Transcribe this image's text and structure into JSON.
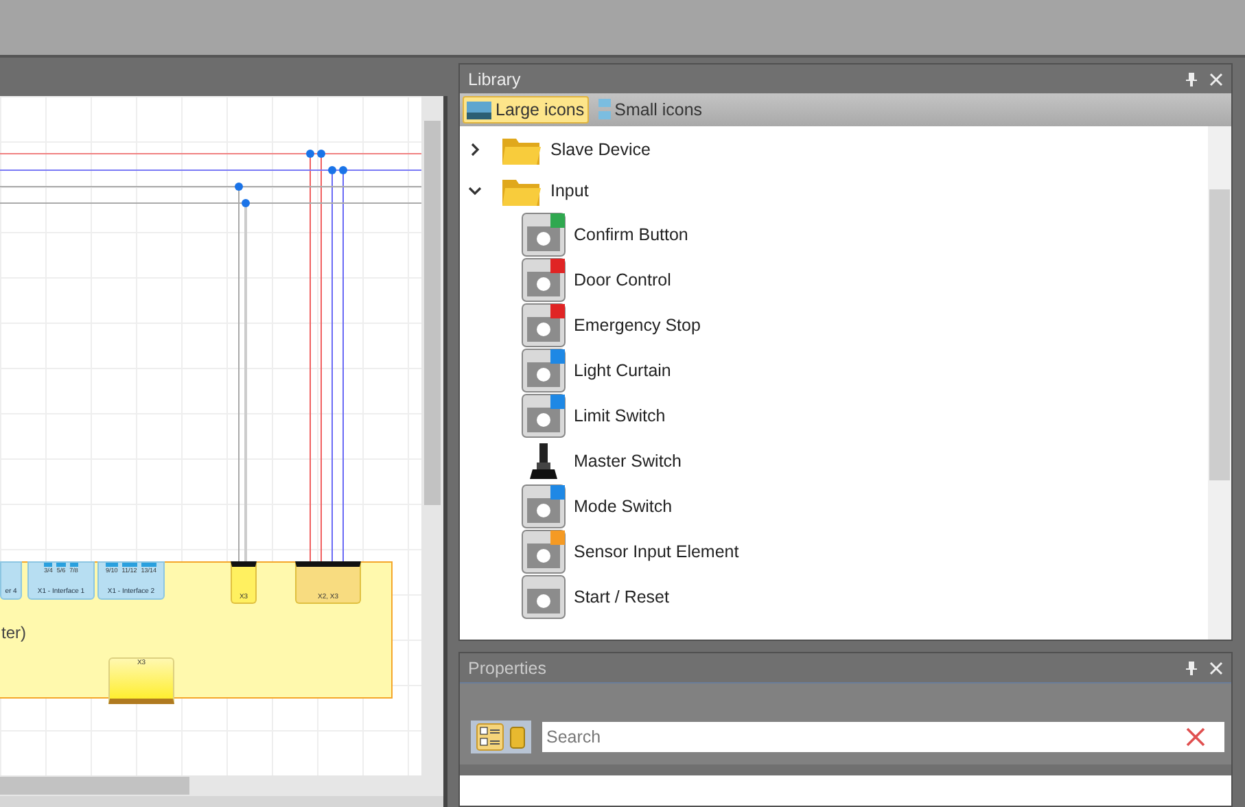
{
  "diagram": {
    "module_label": "ter)",
    "connectors": [
      {
        "label": "er 4"
      },
      {
        "label": "X1 - Interface 1",
        "pins": [
          "3/4",
          "5/6",
          "7/8"
        ]
      },
      {
        "label": "X1 - Interface 2",
        "pins": [
          "9/10",
          "11/12",
          "13/14"
        ]
      }
    ],
    "terminals": [
      {
        "label": "X3"
      },
      {
        "label": "X2, X3"
      }
    ],
    "bottom_terminal": {
      "label": "X3"
    }
  },
  "library": {
    "title": "Library",
    "view_buttons": [
      {
        "label": "Large icons",
        "selected": true
      },
      {
        "label": "Small icons",
        "selected": false
      }
    ],
    "tree": [
      {
        "label": "Slave Device",
        "expanded": false
      },
      {
        "label": "Input",
        "expanded": true,
        "children": [
          {
            "label": "Confirm Button",
            "kind": "tile",
            "color": "#2fa84f"
          },
          {
            "label": "Door Control",
            "kind": "tile",
            "color": "#e02424"
          },
          {
            "label": "Emergency Stop",
            "kind": "tile",
            "color": "#e02424"
          },
          {
            "label": "Light Curtain",
            "kind": "tile",
            "color": "#1e88e5"
          },
          {
            "label": "Limit Switch",
            "kind": "tile",
            "color": "#1e88e5"
          },
          {
            "label": "Master Switch",
            "kind": "plain"
          },
          {
            "label": "Mode Switch",
            "kind": "tile",
            "color": "#1e88e5"
          },
          {
            "label": "Sensor Input Element",
            "kind": "tile",
            "color": "#f59a23"
          },
          {
            "label": "Start / Reset",
            "kind": "tile"
          }
        ]
      }
    ]
  },
  "properties": {
    "title": "Properties",
    "search": {
      "placeholder": "Search"
    }
  }
}
